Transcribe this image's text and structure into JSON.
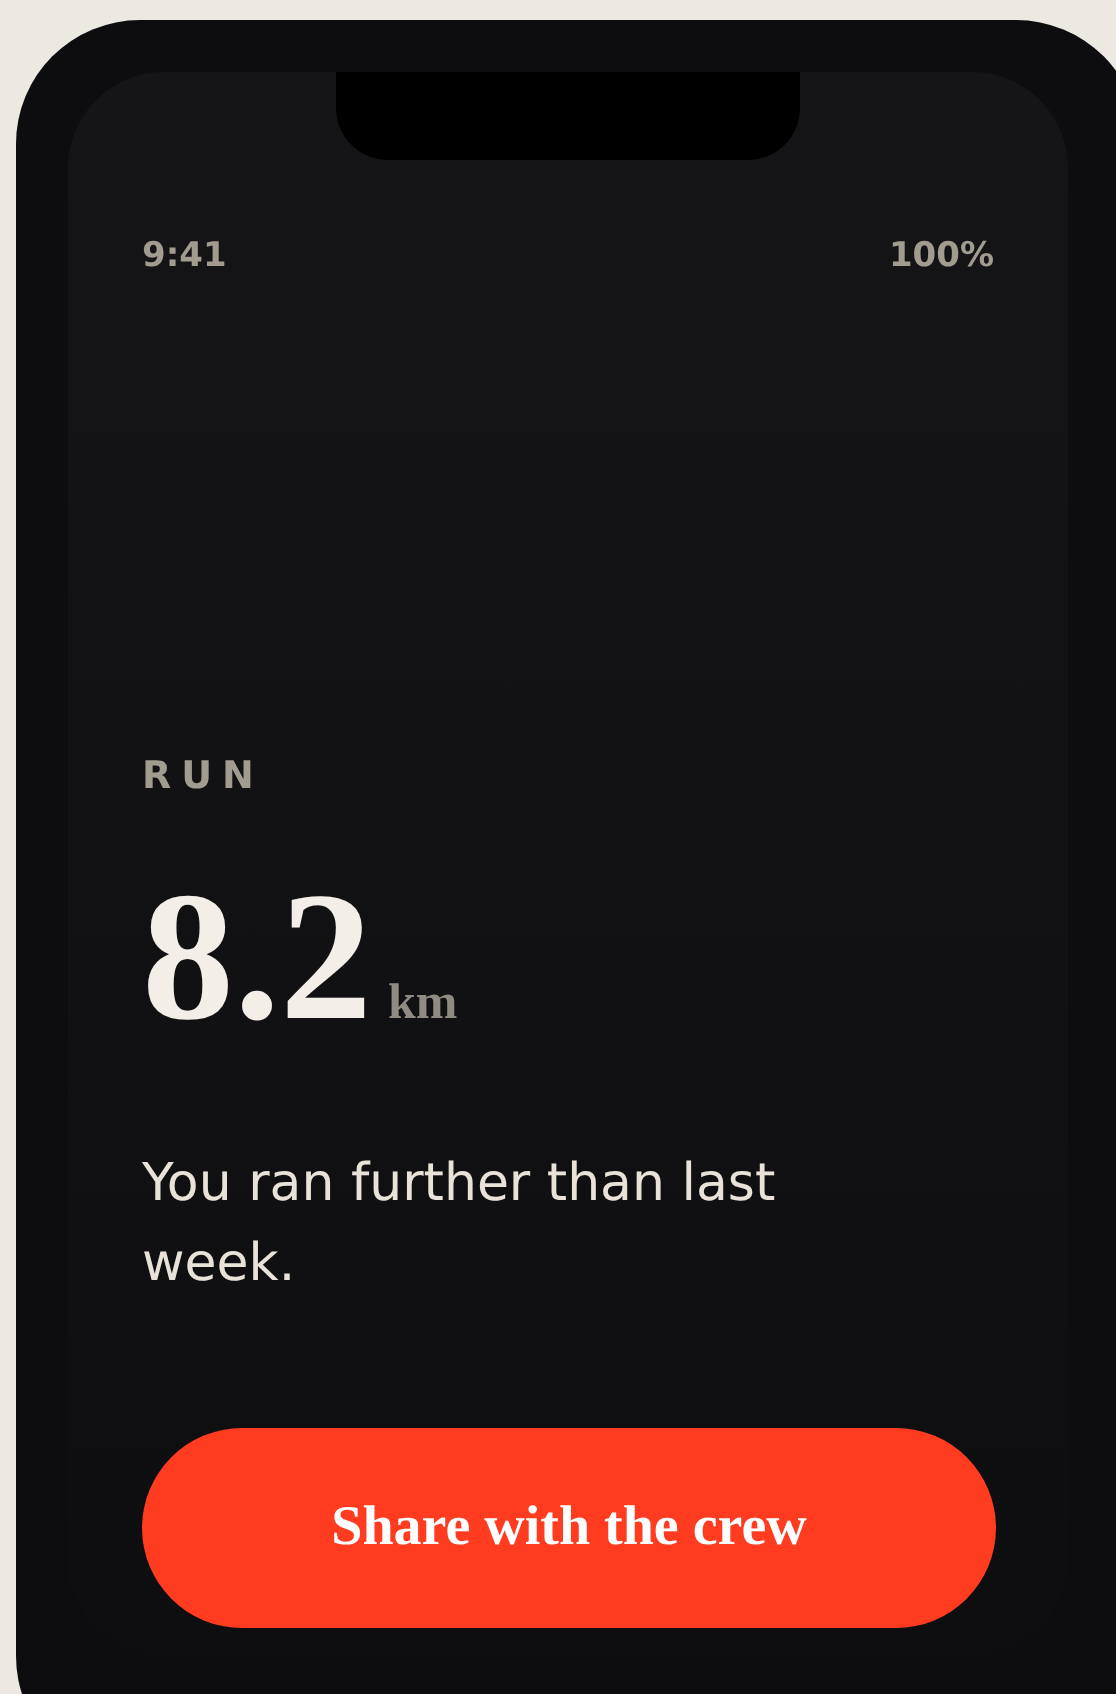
{
  "status_bar": {
    "time": "9:41",
    "battery": "100%"
  },
  "activity": {
    "label": "RUN",
    "value": "8.2",
    "unit": "km",
    "message": "You ran further than last week."
  },
  "button": {
    "label": "Share with the crew"
  }
}
